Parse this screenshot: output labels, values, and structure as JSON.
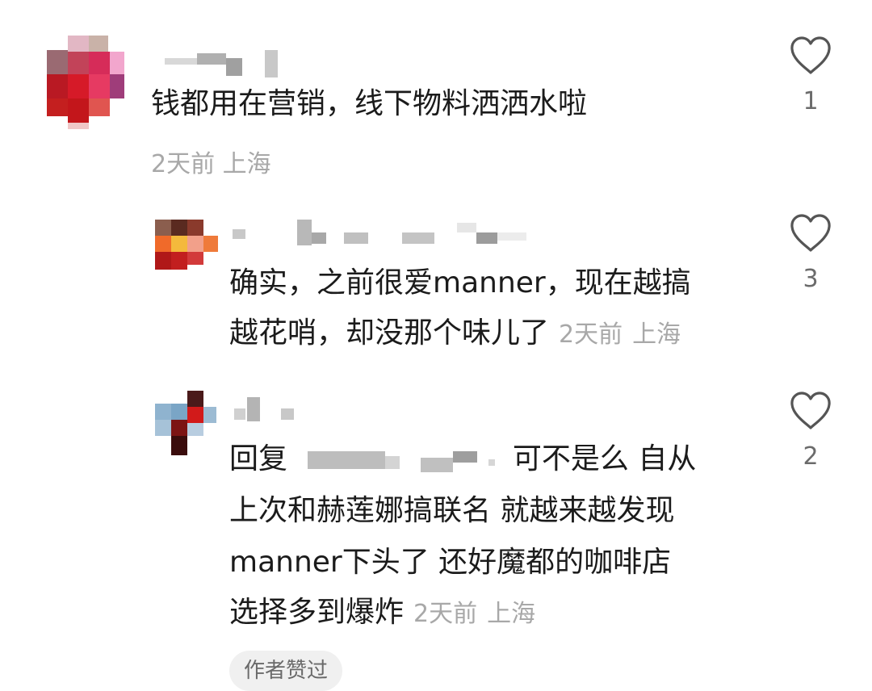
{
  "comments": [
    {
      "text": "钱都用在营销，线下物料洒洒水啦",
      "time": "2天前",
      "location": "上海",
      "likes": "1"
    },
    {
      "text_line1": "确实，之前很爱manner，现在越搞",
      "text_line2": "越花哨，却没那个味儿了",
      "time": "2天前",
      "location": "上海",
      "likes": "3"
    },
    {
      "reply_prefix": "回复",
      "text_line1": "可不是么 自从",
      "text_line2": "上次和赫莲娜搞联名 就越来越发现",
      "text_line3": "manner下头了  还好魔都的咖啡店",
      "text_line4": "选择多到爆炸",
      "time": "2天前",
      "location": "上海",
      "likes": "2",
      "author_badge": "作者赞过"
    }
  ],
  "icons": {
    "like": "heart-outline-icon"
  },
  "colors": {
    "text": "#1b1b1b",
    "meta": "#a8a8a8",
    "icon": "#555555"
  }
}
